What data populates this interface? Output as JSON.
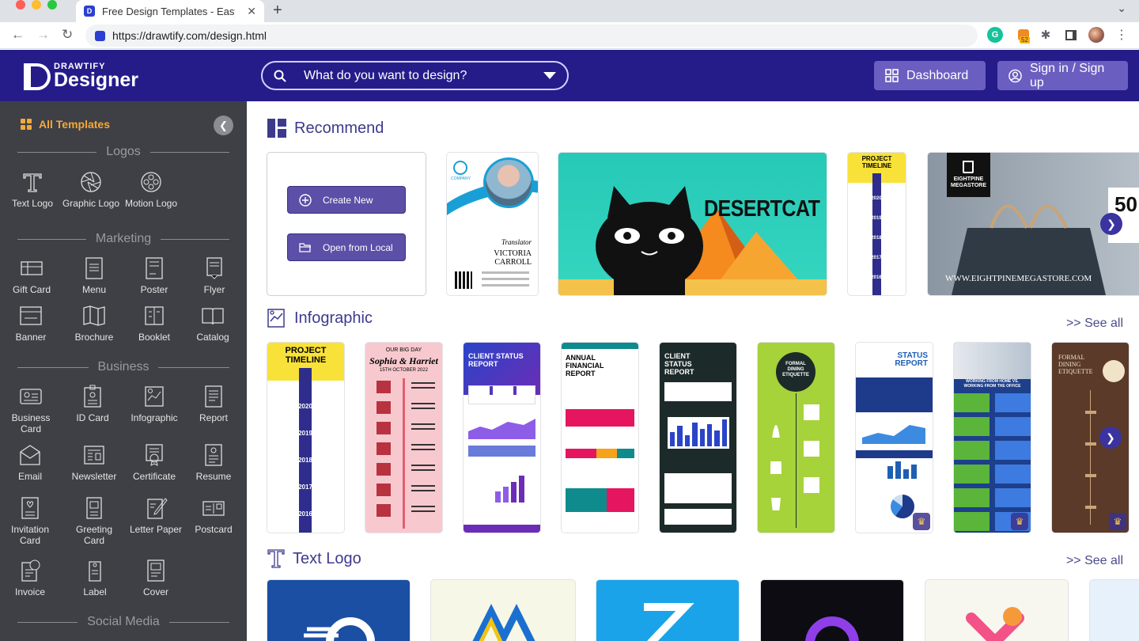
{
  "browser": {
    "tab_title": "Free Design Templates - Easy t",
    "tab_favicon": "D",
    "url": "https://drawtify.com/design.html",
    "ext_badge": "52",
    "ext_grammarly": "G"
  },
  "header": {
    "logo_small": "DRAWTIFY",
    "logo_big": "Designer",
    "search_placeholder": "What do you want to design?",
    "dashboard_label": "Dashboard",
    "signin_label": "Sign in / Sign up",
    "colors": {
      "bar": "#251c8a",
      "button": "#6a5fc0"
    }
  },
  "sidebar": {
    "all_templates": "All Templates",
    "collapse_icon": "chevron-left-icon",
    "sections": {
      "logos": "Logos",
      "marketing": "Marketing",
      "business": "Business",
      "social": "Social Media"
    },
    "logos": [
      "Text Logo",
      "Graphic Logo",
      "Motion Logo"
    ],
    "marketing": [
      "Gift Card",
      "Menu",
      "Poster",
      "Flyer",
      "Banner",
      "Brochure",
      "Booklet",
      "Catalog"
    ],
    "business": [
      "Business Card",
      "ID Card",
      "Infographic",
      "Report",
      "Email",
      "Newsletter",
      "Certificate",
      "Resume",
      "Invitation Card",
      "Greeting Card",
      "Letter Paper",
      "Postcard",
      "Invoice",
      "Label",
      "Cover"
    ]
  },
  "main": {
    "recommend_title": "Recommend",
    "create_new": "Create New",
    "open_local": "Open from Local",
    "infographic_title": "Infographic",
    "text_logo_title": "Text Logo",
    "see_all": ">> See all",
    "cards": {
      "id_role": "Translator",
      "id_name": "VICTORIA CARROLL",
      "id_company": "COMPANY",
      "desertcat": "DESERTCAT",
      "timeline": "PROJECT TIMELINE",
      "timeline_years": [
        "2020",
        "2019",
        "2018",
        "2017",
        "2016"
      ],
      "store_name": "EIGHTPINE MEGASTORE",
      "store_url": "WWW.EIGHTPINEMEGASTORE.COM",
      "store_50": "50",
      "wedding_small": "OUR BIG DAY",
      "wedding_names": "Sophia & Harriet",
      "wedding_date": "15TH OCTOBER 2022",
      "client_status": "CLIENT STATUS REPORT",
      "annual": "ANNUAL FINANCIAL REPORT",
      "client_status2": "CLIENT STATUS REPORT",
      "dining": "FORMAL DINING ETIQUETTE",
      "status_report": "STATUS REPORT",
      "work_home": "WORKING FROM HOME VS. WORKING FROM THE OFFICE",
      "dining2": "FORMAL DINING ETIQUETTE"
    }
  }
}
